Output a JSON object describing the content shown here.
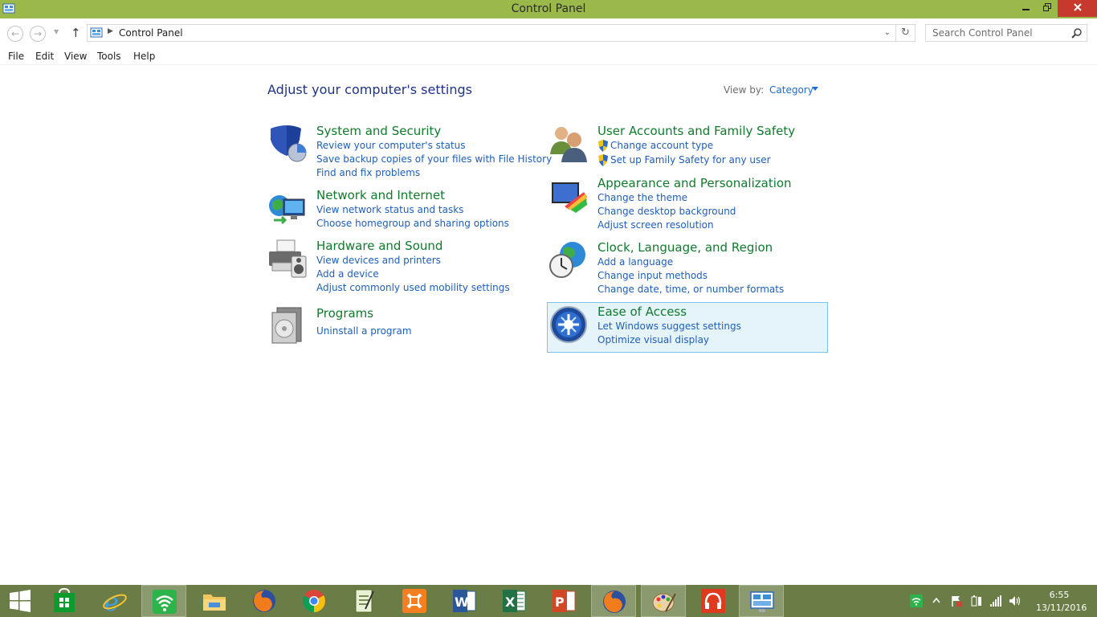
{
  "window": {
    "title": "Control Panel",
    "minimize_icon": "minimize-icon",
    "maximize_icon": "restore-icon",
    "close_icon": "close-icon",
    "titlebar_color": "#9bb94b"
  },
  "nav": {
    "address_text": "Control Panel",
    "search_placeholder": "Search Control Panel"
  },
  "menu": {
    "items": [
      "File",
      "Edit",
      "View",
      "Tools",
      "Help"
    ]
  },
  "main": {
    "heading": "Adjust your computer's settings",
    "view_by_label": "View by:",
    "view_by_value": "Category",
    "categories": [
      {
        "title": "System and Security",
        "icon": "system-security-icon",
        "links": [
          "Review your computer's status",
          "Save backup copies of your files with File History",
          "Find and fix problems"
        ]
      },
      {
        "title": "Network and Internet",
        "icon": "network-internet-icon",
        "links": [
          "View network status and tasks",
          "Choose homegroup and sharing options"
        ]
      },
      {
        "title": "Hardware and Sound",
        "icon": "hardware-sound-icon",
        "links": [
          "View devices and printers",
          "Add a device",
          "Adjust commonly used mobility settings"
        ]
      },
      {
        "title": "Programs",
        "icon": "programs-icon",
        "links": [
          "Uninstall a program"
        ]
      },
      {
        "title": "User Accounts and Family Safety",
        "icon": "user-accounts-icon",
        "links": [
          "Change account type",
          "Set up Family Safety for any user"
        ]
      },
      {
        "title": "Appearance and Personalization",
        "icon": "appearance-icon",
        "links": [
          "Change the theme",
          "Change desktop background",
          "Adjust screen resolution"
        ]
      },
      {
        "title": "Clock, Language, and Region",
        "icon": "clock-language-icon",
        "links": [
          "Add a language",
          "Change input methods",
          "Change date, time, or number formats"
        ]
      },
      {
        "title": "Ease of Access",
        "icon": "ease-of-access-icon",
        "links": [
          "Let Windows suggest settings",
          "Optimize visual display"
        ]
      }
    ]
  },
  "taskbar": {
    "apps": [
      "start-icon",
      "store-icon",
      "internet-explorer-icon",
      "wifi-app-icon",
      "file-explorer-icon",
      "firefox-icon",
      "chrome-icon",
      "notepad-icon",
      "xampp-icon",
      "word-icon",
      "excel-icon",
      "powerpoint-icon",
      "firefox-icon",
      "paint-icon",
      "music-icon",
      "control-panel-icon"
    ],
    "time": "6:55",
    "date": "13/11/2016"
  }
}
